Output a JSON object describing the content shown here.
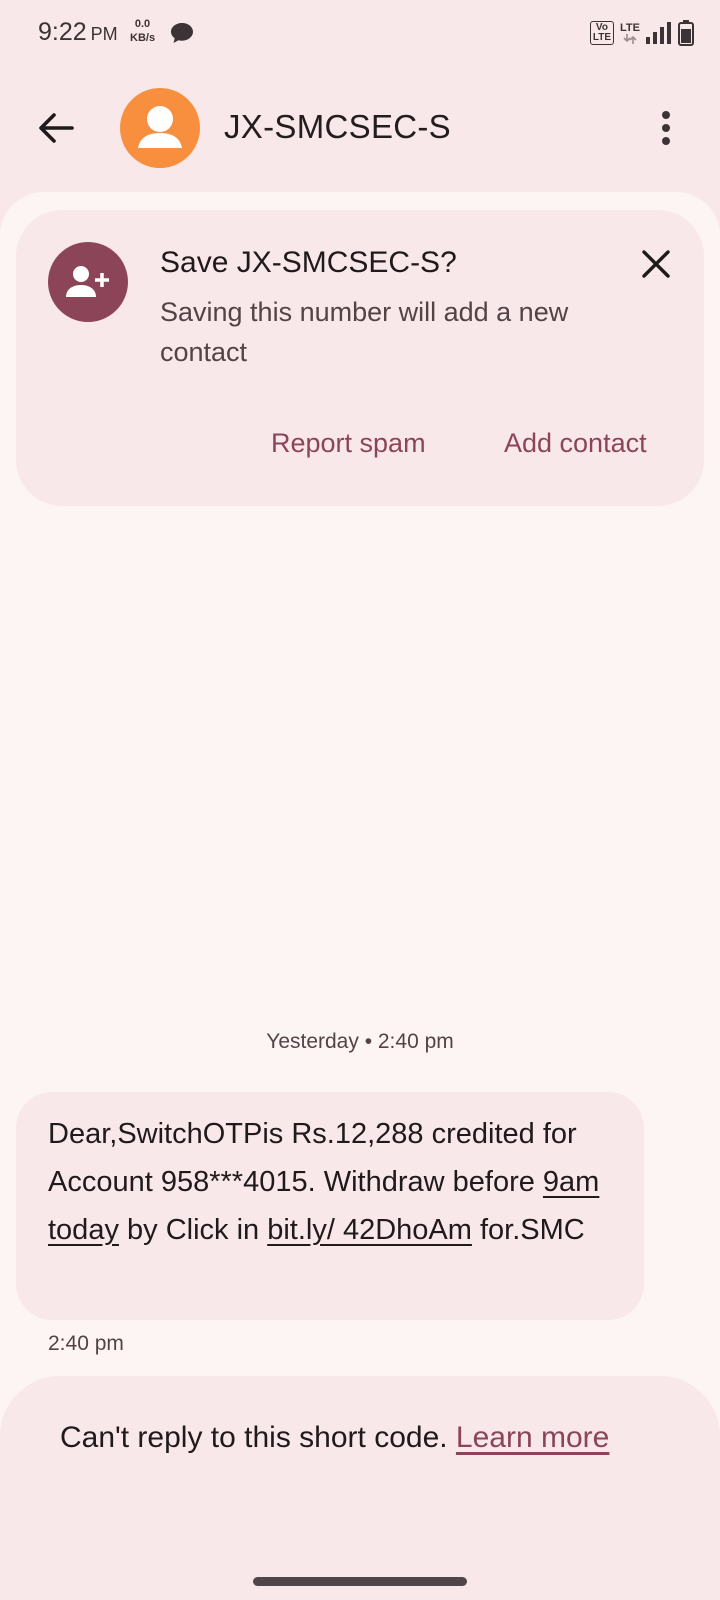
{
  "status_bar": {
    "time": "9:22",
    "ampm": "PM",
    "net_speed_value": "0.0",
    "net_speed_unit": "KB/s",
    "volte_top": "Vo",
    "volte_bottom": "LTE",
    "lte_label": "LTE"
  },
  "app_bar": {
    "title": "JX-SMCSEC-S"
  },
  "save_card": {
    "title": "Save JX-SMCSEC-S?",
    "body": "Saving this number will add a new contact",
    "report_spam": "Report spam",
    "add_contact": "Add contact"
  },
  "conversation": {
    "divider": "Yesterday • 2:40 pm",
    "message": {
      "part1": "Dear,SwitchOTPis Rs.12,288 credited for Account 958***4015. Withdraw before ",
      "link1": "9am today",
      "part2": " by Click in ",
      "link2": "bit.ly/ 42DhoAm",
      "part3": " for.SMC",
      "time": "2:40 pm"
    }
  },
  "reply_panel": {
    "text": "Can't reply to this short code. ",
    "link": "Learn more"
  },
  "colors": {
    "background": "#f9e8e9",
    "surface": "#fdf4f4",
    "accent": "#8c4558",
    "avatar": "#f78f3e"
  }
}
